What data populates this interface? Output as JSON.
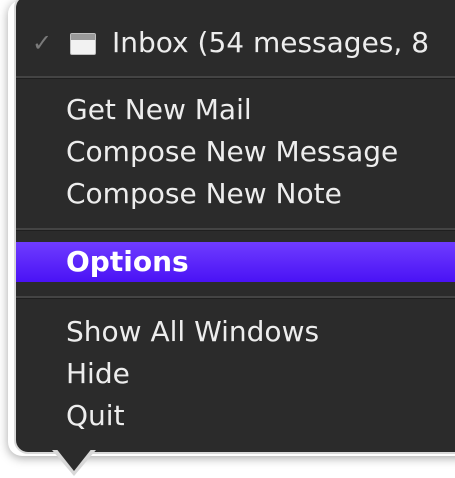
{
  "colors": {
    "menu_background": "#2b2b2b",
    "menu_border": "#d8d8d8",
    "highlight": "#5a20ff",
    "text": "#ededed"
  },
  "header": {
    "checkmark": "✓",
    "icon": "window-icon",
    "label": "Inbox (54 messages, 8"
  },
  "items": {
    "get_new_mail": "Get New Mail",
    "compose_message": "Compose New Message",
    "compose_note": "Compose New Note",
    "options": "Options",
    "show_all_windows": "Show All Windows",
    "hide": "Hide",
    "quit": "Quit"
  }
}
